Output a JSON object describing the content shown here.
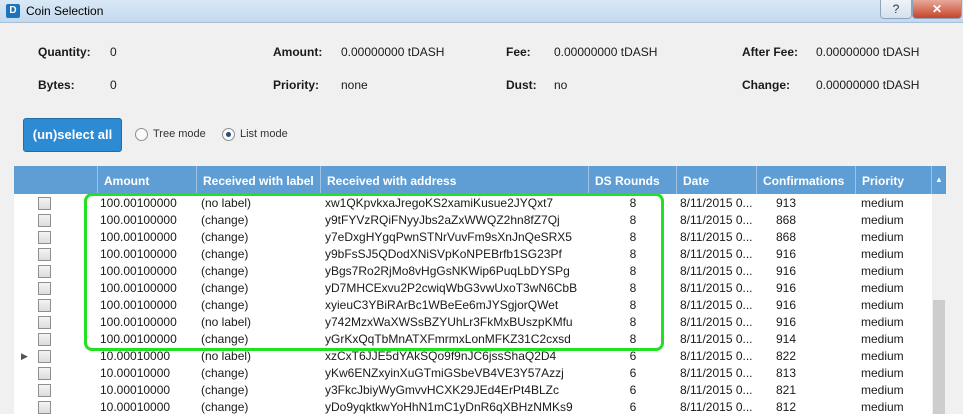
{
  "window": {
    "title": "Coin Selection",
    "help": "?",
    "close": "✕",
    "icon": "D"
  },
  "summary": {
    "quantity_label": "Quantity:",
    "quantity": "0",
    "bytes_label": "Bytes:",
    "bytes": "0",
    "amount_label": "Amount:",
    "amount": "0.00000000 tDASH",
    "priority_label": "Priority:",
    "priority": "none",
    "fee_label": "Fee:",
    "fee": "0.00000000 tDASH",
    "dust_label": "Dust:",
    "dust": "no",
    "afterfee_label": "After Fee:",
    "afterfee": "0.00000000 tDASH",
    "change_label": "Change:",
    "change": "0.00000000 tDASH"
  },
  "controls": {
    "select_all": "(un)select all",
    "tree_mode": "Tree mode",
    "list_mode": "List mode",
    "selected_mode": "list"
  },
  "table": {
    "columns": [
      "Amount",
      "Received with label",
      "Received with address",
      "DS Rounds",
      "Date",
      "Confirmations",
      "Priority"
    ],
    "rows": [
      [
        "100.00100000",
        "(no label)",
        "xw1QKpvkxaJregoKS2xamiKusue2JYQxt7",
        "8",
        "8/11/2015 0...",
        "913",
        "medium"
      ],
      [
        "100.00100000",
        "(change)",
        "y9tFYVzRQiFNyyJbs2aZxWWQZ2hn8fZ7Qj",
        "8",
        "8/11/2015 0...",
        "868",
        "medium"
      ],
      [
        "100.00100000",
        "(change)",
        "y7eDxgHYgqPwnSTNrVuvFm9sXnJnQeSRX5",
        "8",
        "8/11/2015 0...",
        "868",
        "medium"
      ],
      [
        "100.00100000",
        "(change)",
        "y9bFsSJ5QDodXNiSVpKoNPEBrfb1SG23Pf",
        "8",
        "8/11/2015 0...",
        "916",
        "medium"
      ],
      [
        "100.00100000",
        "(change)",
        "yBgs7Ro2RjMo8vHgGsNKWip6PuqLbDYSPg",
        "8",
        "8/11/2015 0...",
        "916",
        "medium"
      ],
      [
        "100.00100000",
        "(change)",
        "yD7MHCExvu2P2cwiqWbG3vwUxoT3wN6CbB",
        "8",
        "8/11/2015 0...",
        "916",
        "medium"
      ],
      [
        "100.00100000",
        "(change)",
        "xyieuC3YBiRArBc1WBeEe6mJYSgjorQWet",
        "8",
        "8/11/2015 0...",
        "916",
        "medium"
      ],
      [
        "100.00100000",
        "(no label)",
        "y742MzxWaXWSsBZYUhLr3FkMxBUszpKMfu",
        "8",
        "8/11/2015 0...",
        "916",
        "medium"
      ],
      [
        "100.00100000",
        "(change)",
        "yGrKxQqTbMnATXFmrmxLonMFKZ31C2cxsd",
        "8",
        "8/11/2015 0...",
        "914",
        "medium"
      ],
      [
        "10.00010000",
        "(no label)",
        "xzCxT6JJE5dYAkSQo9f9nJC6jssShaQ2D4",
        "6",
        "8/11/2015 0...",
        "822",
        "medium"
      ],
      [
        "10.00010000",
        "(change)",
        "yKw6ENZxyinXuGTmiGSbeVB4VE3Y57Azzj",
        "6",
        "8/11/2015 0...",
        "813",
        "medium"
      ],
      [
        "10.00010000",
        "(change)",
        "y3FkcJbiyWyGmvvHCXK29JEd4ErPt4BLZc",
        "6",
        "8/11/2015 0...",
        "821",
        "medium"
      ],
      [
        "10.00010000",
        "(change)",
        "yDo9yqktkwYoHhN1mC1yDnR6qXBHzNMKs9",
        "6",
        "8/11/2015 0...",
        "812",
        "medium"
      ]
    ],
    "expand_row_index": 9,
    "expand_glyph": "▶",
    "scroll_up_glyph": "▲"
  },
  "colors": {
    "header": "#5f9ed5",
    "button": "#2d8bd3",
    "highlight": "#22e022"
  }
}
